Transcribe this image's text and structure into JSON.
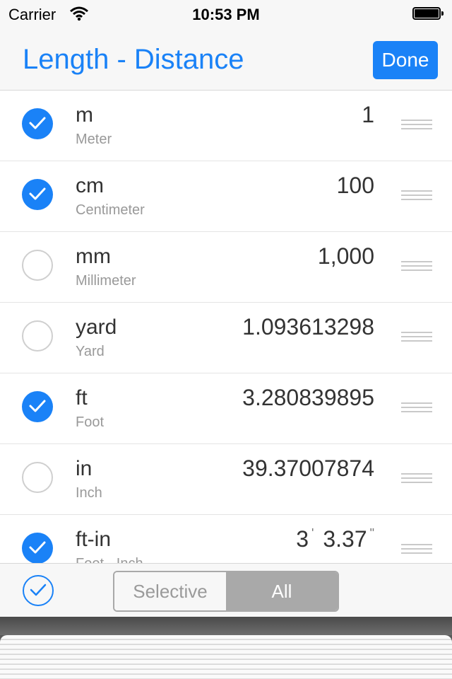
{
  "status_bar": {
    "carrier": "Carrier",
    "time": "10:53 PM"
  },
  "nav": {
    "title": "Length - Distance",
    "done_label": "Done"
  },
  "units": [
    {
      "symbol": "m",
      "name": "Meter",
      "value": "1",
      "selected": true
    },
    {
      "symbol": "cm",
      "name": "Centimeter",
      "value": "100",
      "selected": true
    },
    {
      "symbol": "mm",
      "name": "Millimeter",
      "value": "1,000",
      "selected": false
    },
    {
      "symbol": "yard",
      "name": "Yard",
      "value": "1.093613298",
      "selected": false
    },
    {
      "symbol": "ft",
      "name": "Foot",
      "value": "3.280839895",
      "selected": true
    },
    {
      "symbol": "in",
      "name": "Inch",
      "value": "39.37007874",
      "selected": false
    },
    {
      "symbol": "ft-in",
      "name": "Foot - Inch",
      "feet": "3",
      "inches": "3.37",
      "selected": true
    }
  ],
  "toolbar": {
    "segments": [
      "Selective",
      "All"
    ],
    "active_segment": "All"
  },
  "colors": {
    "accent": "#1a82f7",
    "segment_active": "#a9a9a9"
  }
}
